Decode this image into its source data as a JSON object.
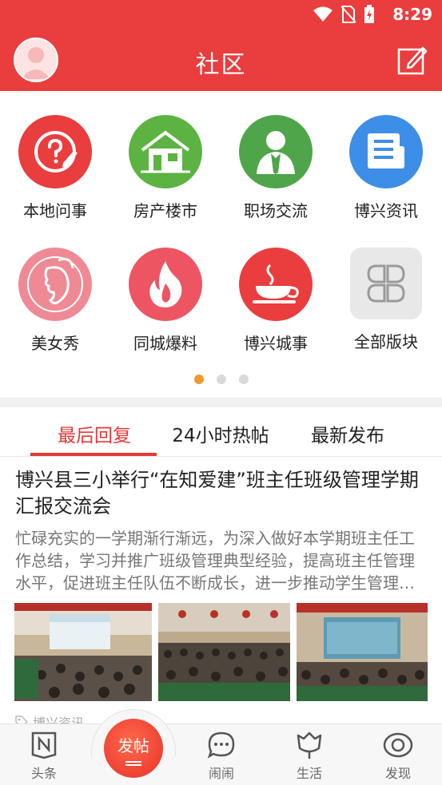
{
  "status": {
    "time": "8:29"
  },
  "header": {
    "title": "社区"
  },
  "categories": [
    {
      "label": "本地问事",
      "icon": "question-pen-icon",
      "color": "#ea3d3d"
    },
    {
      "label": "房产楼市",
      "icon": "house-icon",
      "color": "#5cb342"
    },
    {
      "label": "职场交流",
      "icon": "businessman-icon",
      "color": "#4fa54a"
    },
    {
      "label": "博兴资讯",
      "icon": "newspaper-icon",
      "color": "#3d8ee6"
    },
    {
      "label": "美女秀",
      "icon": "woman-profile-icon",
      "color": "#ef8a95"
    },
    {
      "label": "同城爆料",
      "icon": "flame-icon",
      "color": "#ee5563"
    },
    {
      "label": "博兴城事",
      "icon": "coffee-cup-icon",
      "color": "#ea3d3d"
    },
    {
      "label": "全部版块",
      "icon": "grid-four-icon",
      "color": "#e6e6e6"
    }
  ],
  "pager": {
    "count": 3,
    "active": 0
  },
  "tabs": [
    {
      "label": "最后回复",
      "active": true
    },
    {
      "label": "24小时热帖",
      "active": false
    },
    {
      "label": "最新发布",
      "active": false
    }
  ],
  "post": {
    "title": "博兴县三小举行“在知爱建”班主任班级管理学期汇报交流会",
    "excerpt": "忙碌充实的一学期渐行渐远，为深入做好本学期班主任工作总结，学习并推广班级管理典型经验，提高班主任管理水平，促进班主任队伍不断成长，进一步推动学生管理…",
    "source": "博兴资讯"
  },
  "bottom_nav": [
    {
      "label": "头条",
      "icon": "headline-n-icon"
    },
    {
      "label": "发帖",
      "icon": "post-button"
    },
    {
      "label": "闹闹",
      "icon": "chat-bubble-icon"
    },
    {
      "label": "生活",
      "icon": "tulip-icon"
    },
    {
      "label": "发现",
      "icon": "eye-icon"
    }
  ]
}
